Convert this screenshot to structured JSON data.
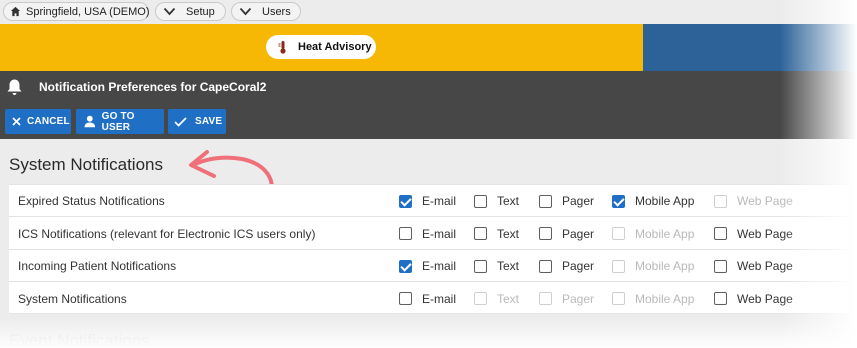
{
  "breadcrumbs": [
    {
      "label": "Springfield, USA (DEMO)",
      "icon": "home-icon"
    },
    {
      "label": "Setup",
      "icon": "chevron-down-icon"
    },
    {
      "label": "Users",
      "icon": "chevron-down-icon"
    }
  ],
  "banner": {
    "advisory_label": "Heat Advisory",
    "advisory_icon": "thermometer-icon",
    "colors": {
      "yellow": "#f7b705",
      "blue": "#2d6299"
    }
  },
  "header": {
    "title": "Notification Preferences for CapeCoral2",
    "icon": "bell-icon"
  },
  "toolbar": {
    "cancel_label": "CANCEL",
    "go_to_user_label": "GO TO USER",
    "save_label": "SAVE",
    "button_color": "#1f6fc5"
  },
  "section": {
    "title": "System Notifications",
    "next_title": "Event Notifications"
  },
  "channels": [
    "E-mail",
    "Text",
    "Pager",
    "Mobile App",
    "Web Page"
  ],
  "rows": [
    {
      "label": "Expired Status Notifications",
      "options": [
        {
          "checked": true,
          "enabled": true
        },
        {
          "checked": false,
          "enabled": true
        },
        {
          "checked": false,
          "enabled": true
        },
        {
          "checked": true,
          "enabled": true
        },
        {
          "checked": false,
          "enabled": false
        }
      ]
    },
    {
      "label": "ICS Notifications (relevant for Electronic ICS users only)",
      "options": [
        {
          "checked": false,
          "enabled": true
        },
        {
          "checked": false,
          "enabled": true
        },
        {
          "checked": false,
          "enabled": true
        },
        {
          "checked": false,
          "enabled": false
        },
        {
          "checked": false,
          "enabled": true
        }
      ]
    },
    {
      "label": "Incoming Patient Notifications",
      "options": [
        {
          "checked": true,
          "enabled": true
        },
        {
          "checked": false,
          "enabled": true
        },
        {
          "checked": false,
          "enabled": true
        },
        {
          "checked": false,
          "enabled": false
        },
        {
          "checked": false,
          "enabled": true
        }
      ]
    },
    {
      "label": "System Notifications",
      "options": [
        {
          "checked": false,
          "enabled": true
        },
        {
          "checked": false,
          "enabled": false
        },
        {
          "checked": false,
          "enabled": false
        },
        {
          "checked": false,
          "enabled": false
        },
        {
          "checked": false,
          "enabled": true
        }
      ]
    }
  ],
  "annotation_color": "#f0707a"
}
